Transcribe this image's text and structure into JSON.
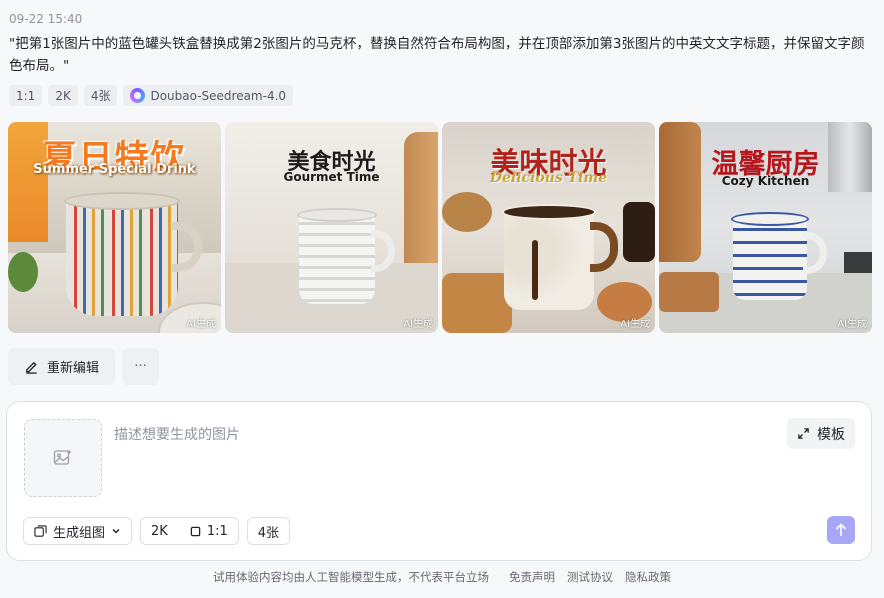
{
  "timestamp": "09-22 15:40",
  "prompt": "\"把第1张图片中的蓝色罐头铁盒替换成第2张图片的马克杯，替换自然符合布局构图，并在顶部添加第3张图片的中英文文字标题，并保留文字颜色布局。\"",
  "tags": {
    "ratio": "1:1",
    "resolution": "2K",
    "count": "4张",
    "model": "Doubao-Seedream-4.0"
  },
  "images": [
    {
      "title_cn": "夏日特饮",
      "title_en": "Summer Special Drink",
      "badge": "AI生成"
    },
    {
      "title_cn": "美食时光",
      "title_en": "Gourmet Time",
      "badge": "AI生成"
    },
    {
      "title_cn": "美味时光",
      "title_en": "Delicious Time",
      "badge": "AI生成"
    },
    {
      "title_cn": "温馨厨房",
      "title_en": "Cozy Kitchen",
      "badge": "AI生成"
    }
  ],
  "actions": {
    "reedit_label": "重新编辑",
    "more_label": "···"
  },
  "composer": {
    "placeholder": "描述想要生成的图片",
    "template_label": "模板",
    "mode_label": "生成组图",
    "resolution": "2K",
    "ratio": "1:1",
    "count": "4张"
  },
  "footer": {
    "disclaimer": "试用体验内容均由人工智能模型生成，不代表平台立场",
    "links": [
      "免责声明",
      "测试协议",
      "隐私政策"
    ]
  },
  "colors": {
    "accent_send": "#a7a8f5",
    "title_red": "#b3231c",
    "title_orange": "#f47a1f"
  }
}
